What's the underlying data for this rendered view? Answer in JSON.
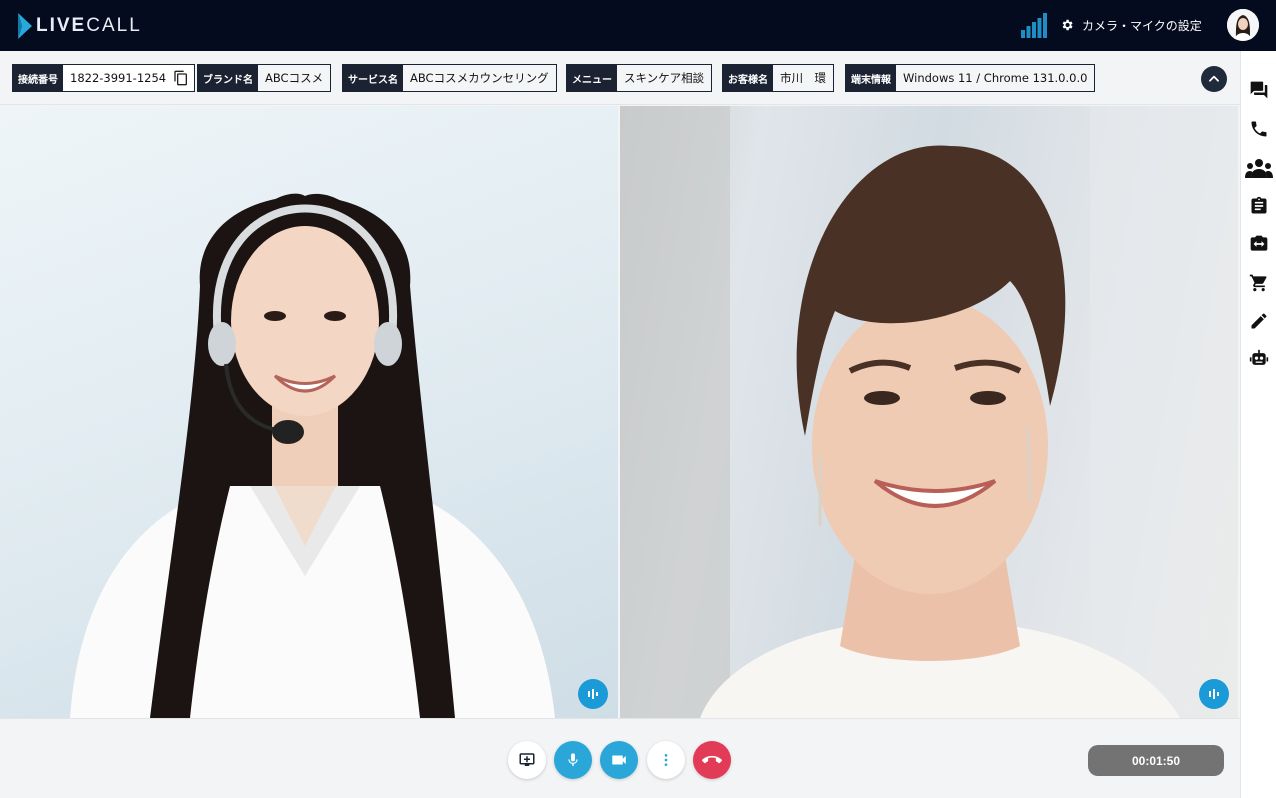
{
  "app": {
    "logo_live": "LIVE",
    "logo_call": "CALL",
    "settings_label": "カメラ・マイクの設定",
    "accent": "#2aa7d8",
    "topbar_bg": "#050b1f"
  },
  "info": {
    "connection": {
      "label": "接続番号",
      "value": "1822-3991-1254"
    },
    "brand": {
      "label": "ブランド名",
      "value": "ABCコスメ"
    },
    "service": {
      "label": "サービス名",
      "value": "ABCコスメカウンセリング"
    },
    "menu": {
      "label": "メニュー",
      "value": "スキンケア相談"
    },
    "customer": {
      "label": "お客様名",
      "value": "市川　環"
    },
    "device": {
      "label": "端末情報",
      "value": "Windows 11 / Chrome 131.0.0.0"
    }
  },
  "sidebar": {
    "icons": [
      "chat-icon",
      "phone-icon",
      "group-icon",
      "clipboard-icon",
      "camera-switch-icon",
      "cart-icon",
      "pencil-icon",
      "robot-icon"
    ]
  },
  "controls": {
    "timer": "00:01:50",
    "end_call_color": "#e23b58"
  }
}
